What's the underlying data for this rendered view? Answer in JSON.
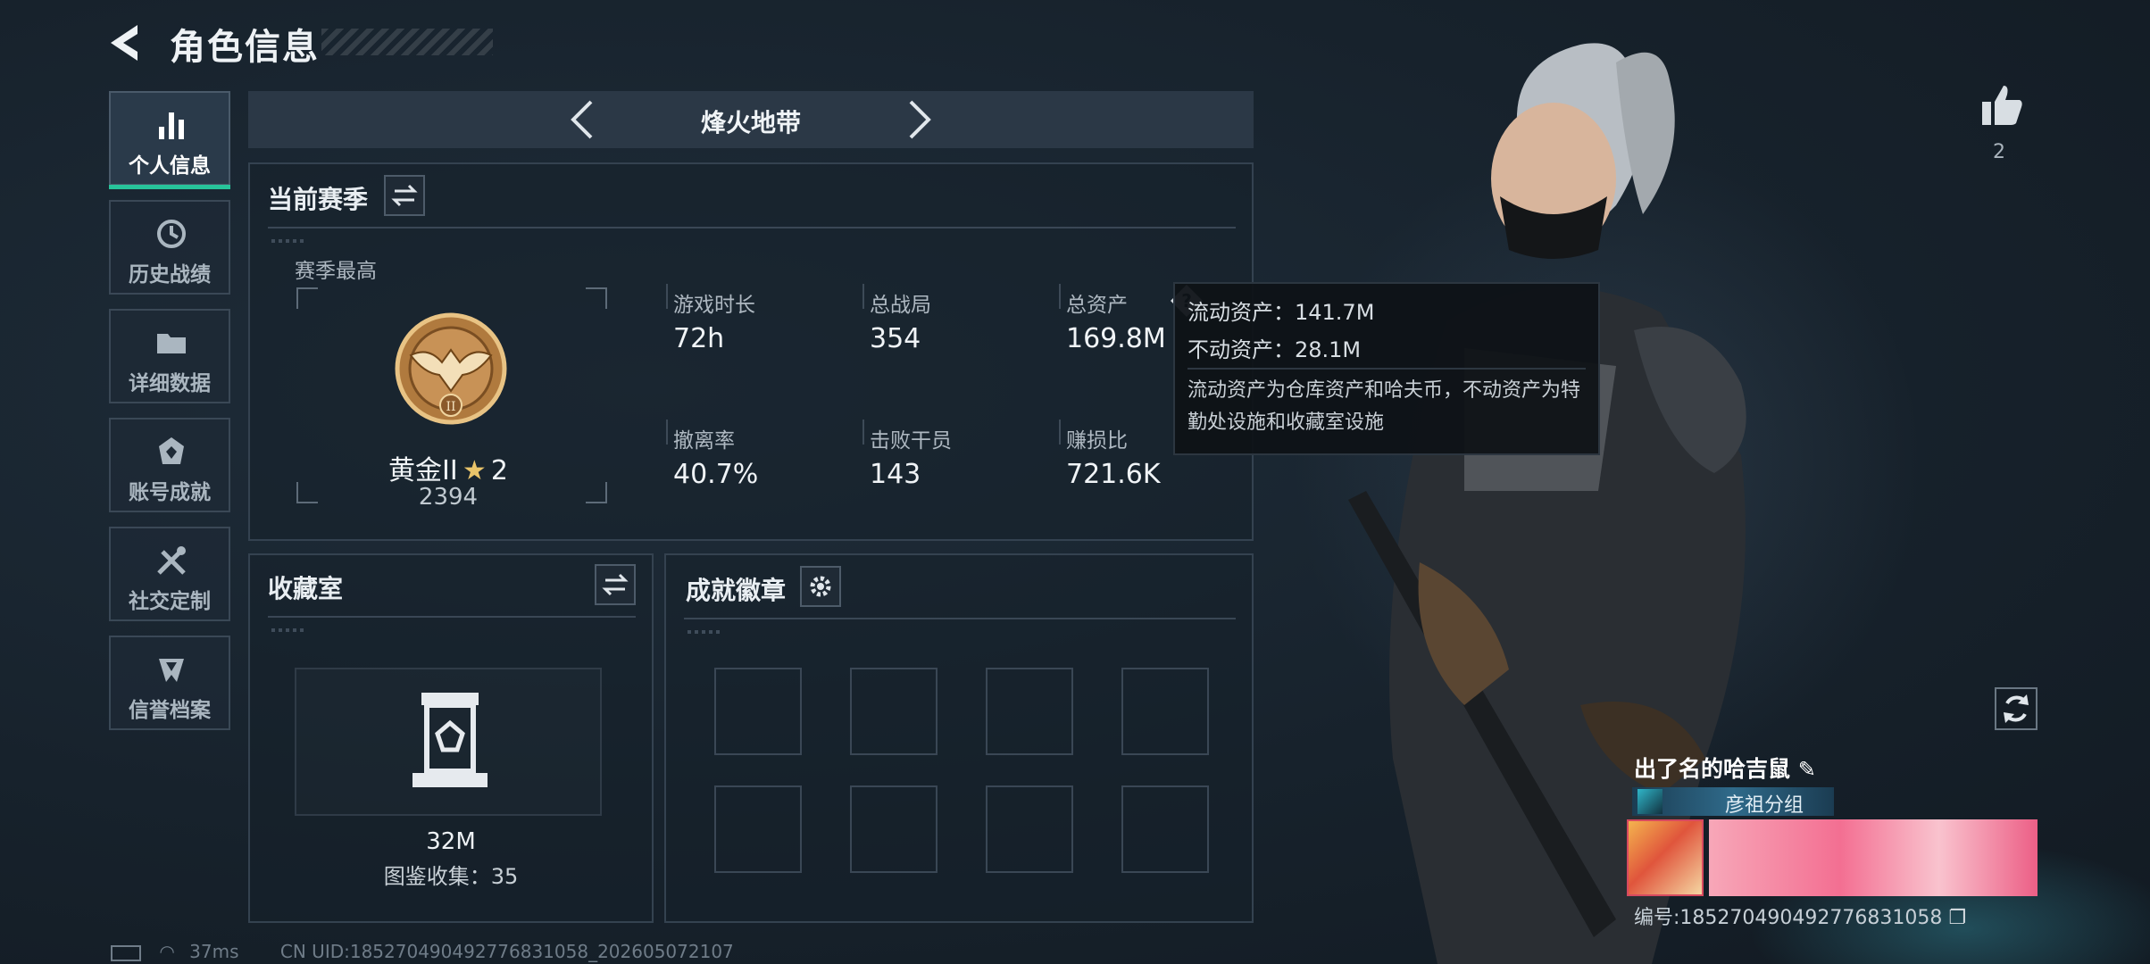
{
  "header": {
    "title": "角色信息"
  },
  "sidebar": {
    "items": [
      {
        "label": "个人信息",
        "icon": "bar-chart-icon",
        "active": true
      },
      {
        "label": "历史战绩",
        "icon": "history-icon"
      },
      {
        "label": "详细数据",
        "icon": "folder-icon"
      },
      {
        "label": "账号成就",
        "icon": "achievement-icon"
      },
      {
        "label": "社交定制",
        "icon": "tools-icon"
      },
      {
        "label": "信誉档案",
        "icon": "shield-icon"
      }
    ]
  },
  "mode": {
    "title": "烽火地带"
  },
  "season": {
    "title": "当前赛季",
    "best_label": "赛季最高",
    "rank_name": "黄金II",
    "rank_stars": "2",
    "rank_score": "2394",
    "stats": [
      {
        "label": "游戏时长",
        "value": "72h"
      },
      {
        "label": "总战局",
        "value": "354"
      },
      {
        "label": "总资产",
        "value": "169.8M"
      },
      {
        "label": "撤离率",
        "value": "40.7%"
      },
      {
        "label": "击败干员",
        "value": "143"
      },
      {
        "label": "赚损比",
        "value": "721.6K"
      }
    ]
  },
  "tooltip": {
    "liquid": "流动资产：141.7M",
    "fixed": "不动资产：28.1M",
    "desc": "流动资产为仓库资产和哈夫币，不动资产为特勤处设施和收藏室设施"
  },
  "collection": {
    "title": "收藏室",
    "value": "32M",
    "catalog": "图鉴收集：35"
  },
  "badges": {
    "title": "成就徽章"
  },
  "profile": {
    "likes": "2",
    "name": "出了名的哈吉鼠",
    "clan": "彦祖分组",
    "uid": "编号:18527049049277683105​8"
  },
  "footer": {
    "ping": "37ms",
    "uid_line": "CN UID:18527049049277683105​8_202605072107"
  },
  "colors": {
    "accent": "#27c49a",
    "panel_bg": "#16202a"
  }
}
